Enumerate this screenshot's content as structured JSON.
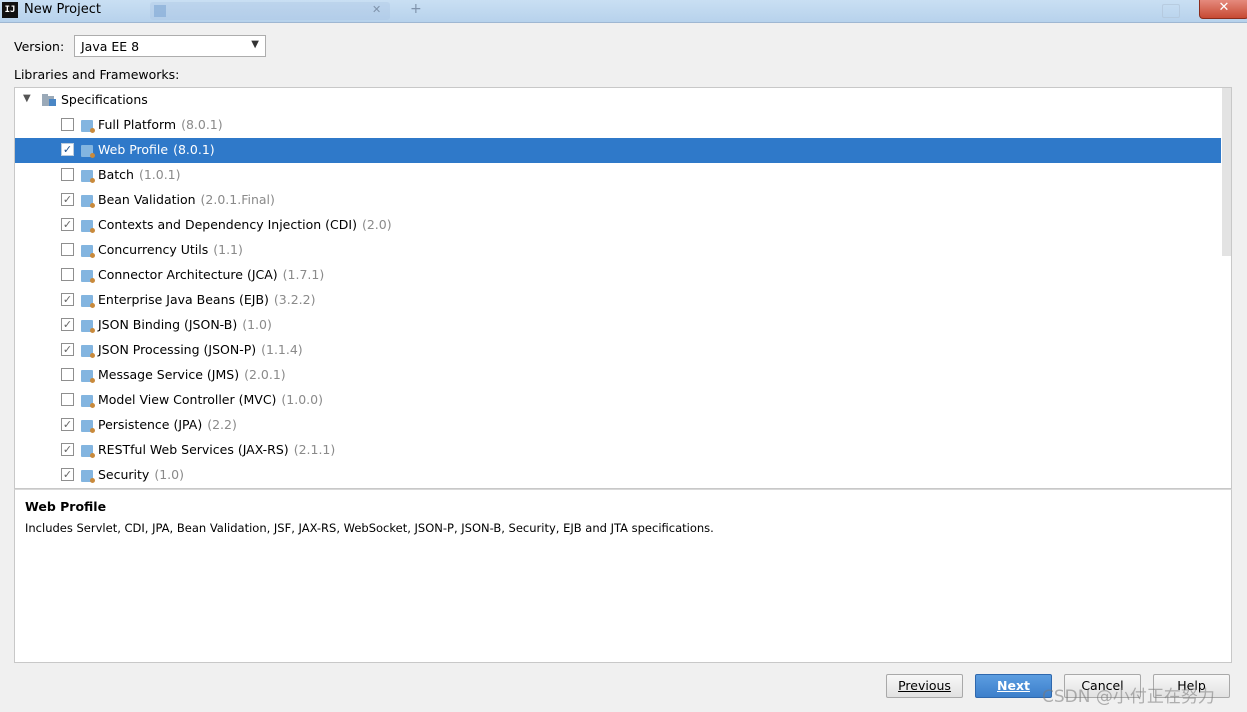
{
  "window": {
    "title": "New Project",
    "app_icon_text": "IJ",
    "close_symbol": "✕"
  },
  "version": {
    "label": "Version:",
    "selected": "Java EE 8"
  },
  "libraries_label": "Libraries and Frameworks:",
  "tree": {
    "root_label": "Specifications",
    "items": [
      {
        "name": "Full Platform",
        "version": "(8.0.1)",
        "checked": false,
        "selected": false
      },
      {
        "name": "Web Profile",
        "version": "(8.0.1)",
        "checked": true,
        "selected": true
      },
      {
        "name": "Batch",
        "version": "(1.0.1)",
        "checked": false,
        "selected": false
      },
      {
        "name": "Bean Validation",
        "version": "(2.0.1.Final)",
        "checked": true,
        "selected": false
      },
      {
        "name": "Contexts and Dependency Injection (CDI)",
        "version": "(2.0)",
        "checked": true,
        "selected": false
      },
      {
        "name": "Concurrency Utils",
        "version": "(1.1)",
        "checked": false,
        "selected": false
      },
      {
        "name": "Connector Architecture (JCA)",
        "version": "(1.7.1)",
        "checked": false,
        "selected": false
      },
      {
        "name": "Enterprise Java Beans (EJB)",
        "version": "(3.2.2)",
        "checked": true,
        "selected": false
      },
      {
        "name": "JSON Binding (JSON-B)",
        "version": "(1.0)",
        "checked": true,
        "selected": false
      },
      {
        "name": "JSON Processing (JSON-P)",
        "version": "(1.1.4)",
        "checked": true,
        "selected": false
      },
      {
        "name": "Message Service (JMS)",
        "version": "(2.0.1)",
        "checked": false,
        "selected": false
      },
      {
        "name": "Model View Controller (MVC)",
        "version": "(1.0.0)",
        "checked": false,
        "selected": false
      },
      {
        "name": "Persistence (JPA)",
        "version": "(2.2)",
        "checked": true,
        "selected": false
      },
      {
        "name": "RESTful Web Services (JAX-RS)",
        "version": "(2.1.1)",
        "checked": true,
        "selected": false
      },
      {
        "name": "Security",
        "version": "(1.0)",
        "checked": true,
        "selected": false
      }
    ]
  },
  "description": {
    "title": "Web Profile",
    "text": "Includes Servlet, CDI, JPA, Bean Validation, JSF, JAX-RS, WebSocket, JSON-P, JSON-B, Security, EJB and JTA specifications."
  },
  "buttons": {
    "previous": "Previous",
    "next": "Next",
    "cancel": "Cancel",
    "help": "Help"
  },
  "watermark": "CSDN @小付正在努力"
}
